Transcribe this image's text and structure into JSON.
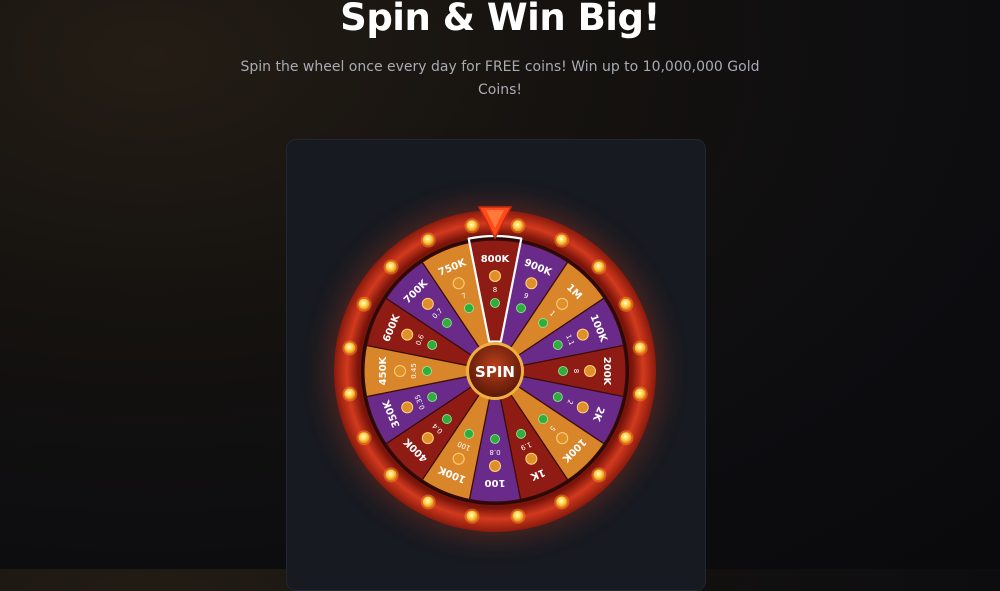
{
  "header": {
    "title": "Spin & Win Big!",
    "subtitle": "Spin the wheel once every day for FREE coins! Win up to 10,000,000 Gold Coins!"
  },
  "wheel": {
    "spin_label": "SPIN",
    "pointer_icon": "pointer-arrow-icon",
    "coin_icon": "gold-coin-icon",
    "sweep_icon": "sweep-coin-icon",
    "colors": {
      "rim": "#c6301a",
      "rim_dark": "#8a1a0c",
      "bulb": "#ffd24a",
      "hub": "#8d2a14",
      "gold_coin": "#e0902a",
      "sweep_coin": "#2fae3c",
      "segment_orange": "#d9862a",
      "segment_purple": "#6a2a8a",
      "segment_red": "#8e1c14"
    },
    "segments": [
      {
        "gold": "800K",
        "sweep": "8",
        "color": "red"
      },
      {
        "gold": "900K",
        "sweep": "9",
        "color": "purple"
      },
      {
        "gold": "1M",
        "sweep": "1",
        "color": "orange"
      },
      {
        "gold": "100K",
        "sweep": "1.1",
        "color": "purple"
      },
      {
        "gold": "200K",
        "sweep": "8",
        "color": "red"
      },
      {
        "gold": "2K",
        "sweep": "2",
        "color": "purple"
      },
      {
        "gold": "100K",
        "sweep": "5",
        "color": "orange"
      },
      {
        "gold": "1K",
        "sweep": "1.9",
        "color": "red"
      },
      {
        "gold": "100",
        "sweep": "0.8",
        "color": "purple"
      },
      {
        "gold": "100K",
        "sweep": "100",
        "color": "orange"
      },
      {
        "gold": "400K",
        "sweep": "0.4",
        "color": "red"
      },
      {
        "gold": "350K",
        "sweep": "0.35",
        "color": "purple"
      },
      {
        "gold": "450K",
        "sweep": "0.45",
        "color": "orange"
      },
      {
        "gold": "600K",
        "sweep": "0.6",
        "color": "red"
      },
      {
        "gold": "700K",
        "sweep": "0.7",
        "color": "purple"
      },
      {
        "gold": "750K",
        "sweep": "7",
        "color": "orange"
      }
    ]
  }
}
